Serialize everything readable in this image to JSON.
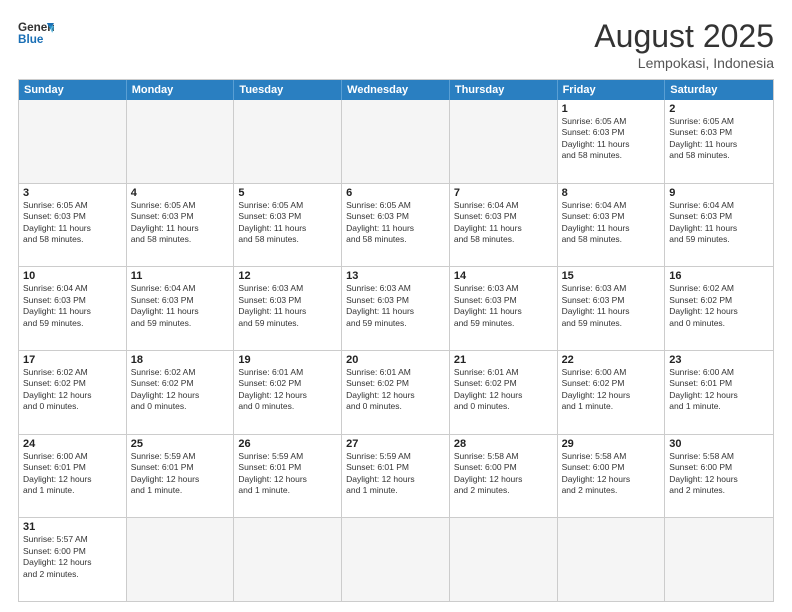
{
  "header": {
    "logo_general": "General",
    "logo_blue": "Blue",
    "month_title": "August 2025",
    "location": "Lempokasi, Indonesia"
  },
  "weekdays": [
    "Sunday",
    "Monday",
    "Tuesday",
    "Wednesday",
    "Thursday",
    "Friday",
    "Saturday"
  ],
  "rows": [
    [
      {
        "day": "",
        "info": ""
      },
      {
        "day": "",
        "info": ""
      },
      {
        "day": "",
        "info": ""
      },
      {
        "day": "",
        "info": ""
      },
      {
        "day": "",
        "info": ""
      },
      {
        "day": "1",
        "info": "Sunrise: 6:05 AM\nSunset: 6:03 PM\nDaylight: 11 hours\nand 58 minutes."
      },
      {
        "day": "2",
        "info": "Sunrise: 6:05 AM\nSunset: 6:03 PM\nDaylight: 11 hours\nand 58 minutes."
      }
    ],
    [
      {
        "day": "3",
        "info": "Sunrise: 6:05 AM\nSunset: 6:03 PM\nDaylight: 11 hours\nand 58 minutes."
      },
      {
        "day": "4",
        "info": "Sunrise: 6:05 AM\nSunset: 6:03 PM\nDaylight: 11 hours\nand 58 minutes."
      },
      {
        "day": "5",
        "info": "Sunrise: 6:05 AM\nSunset: 6:03 PM\nDaylight: 11 hours\nand 58 minutes."
      },
      {
        "day": "6",
        "info": "Sunrise: 6:05 AM\nSunset: 6:03 PM\nDaylight: 11 hours\nand 58 minutes."
      },
      {
        "day": "7",
        "info": "Sunrise: 6:04 AM\nSunset: 6:03 PM\nDaylight: 11 hours\nand 58 minutes."
      },
      {
        "day": "8",
        "info": "Sunrise: 6:04 AM\nSunset: 6:03 PM\nDaylight: 11 hours\nand 58 minutes."
      },
      {
        "day": "9",
        "info": "Sunrise: 6:04 AM\nSunset: 6:03 PM\nDaylight: 11 hours\nand 59 minutes."
      }
    ],
    [
      {
        "day": "10",
        "info": "Sunrise: 6:04 AM\nSunset: 6:03 PM\nDaylight: 11 hours\nand 59 minutes."
      },
      {
        "day": "11",
        "info": "Sunrise: 6:04 AM\nSunset: 6:03 PM\nDaylight: 11 hours\nand 59 minutes."
      },
      {
        "day": "12",
        "info": "Sunrise: 6:03 AM\nSunset: 6:03 PM\nDaylight: 11 hours\nand 59 minutes."
      },
      {
        "day": "13",
        "info": "Sunrise: 6:03 AM\nSunset: 6:03 PM\nDaylight: 11 hours\nand 59 minutes."
      },
      {
        "day": "14",
        "info": "Sunrise: 6:03 AM\nSunset: 6:03 PM\nDaylight: 11 hours\nand 59 minutes."
      },
      {
        "day": "15",
        "info": "Sunrise: 6:03 AM\nSunset: 6:03 PM\nDaylight: 11 hours\nand 59 minutes."
      },
      {
        "day": "16",
        "info": "Sunrise: 6:02 AM\nSunset: 6:02 PM\nDaylight: 12 hours\nand 0 minutes."
      }
    ],
    [
      {
        "day": "17",
        "info": "Sunrise: 6:02 AM\nSunset: 6:02 PM\nDaylight: 12 hours\nand 0 minutes."
      },
      {
        "day": "18",
        "info": "Sunrise: 6:02 AM\nSunset: 6:02 PM\nDaylight: 12 hours\nand 0 minutes."
      },
      {
        "day": "19",
        "info": "Sunrise: 6:01 AM\nSunset: 6:02 PM\nDaylight: 12 hours\nand 0 minutes."
      },
      {
        "day": "20",
        "info": "Sunrise: 6:01 AM\nSunset: 6:02 PM\nDaylight: 12 hours\nand 0 minutes."
      },
      {
        "day": "21",
        "info": "Sunrise: 6:01 AM\nSunset: 6:02 PM\nDaylight: 12 hours\nand 0 minutes."
      },
      {
        "day": "22",
        "info": "Sunrise: 6:00 AM\nSunset: 6:02 PM\nDaylight: 12 hours\nand 1 minute."
      },
      {
        "day": "23",
        "info": "Sunrise: 6:00 AM\nSunset: 6:01 PM\nDaylight: 12 hours\nand 1 minute."
      }
    ],
    [
      {
        "day": "24",
        "info": "Sunrise: 6:00 AM\nSunset: 6:01 PM\nDaylight: 12 hours\nand 1 minute."
      },
      {
        "day": "25",
        "info": "Sunrise: 5:59 AM\nSunset: 6:01 PM\nDaylight: 12 hours\nand 1 minute."
      },
      {
        "day": "26",
        "info": "Sunrise: 5:59 AM\nSunset: 6:01 PM\nDaylight: 12 hours\nand 1 minute."
      },
      {
        "day": "27",
        "info": "Sunrise: 5:59 AM\nSunset: 6:01 PM\nDaylight: 12 hours\nand 1 minute."
      },
      {
        "day": "28",
        "info": "Sunrise: 5:58 AM\nSunset: 6:00 PM\nDaylight: 12 hours\nand 2 minutes."
      },
      {
        "day": "29",
        "info": "Sunrise: 5:58 AM\nSunset: 6:00 PM\nDaylight: 12 hours\nand 2 minutes."
      },
      {
        "day": "30",
        "info": "Sunrise: 5:58 AM\nSunset: 6:00 PM\nDaylight: 12 hours\nand 2 minutes."
      }
    ],
    [
      {
        "day": "31",
        "info": "Sunrise: 5:57 AM\nSunset: 6:00 PM\nDaylight: 12 hours\nand 2 minutes."
      },
      {
        "day": "",
        "info": ""
      },
      {
        "day": "",
        "info": ""
      },
      {
        "day": "",
        "info": ""
      },
      {
        "day": "",
        "info": ""
      },
      {
        "day": "",
        "info": ""
      },
      {
        "day": "",
        "info": ""
      }
    ]
  ]
}
